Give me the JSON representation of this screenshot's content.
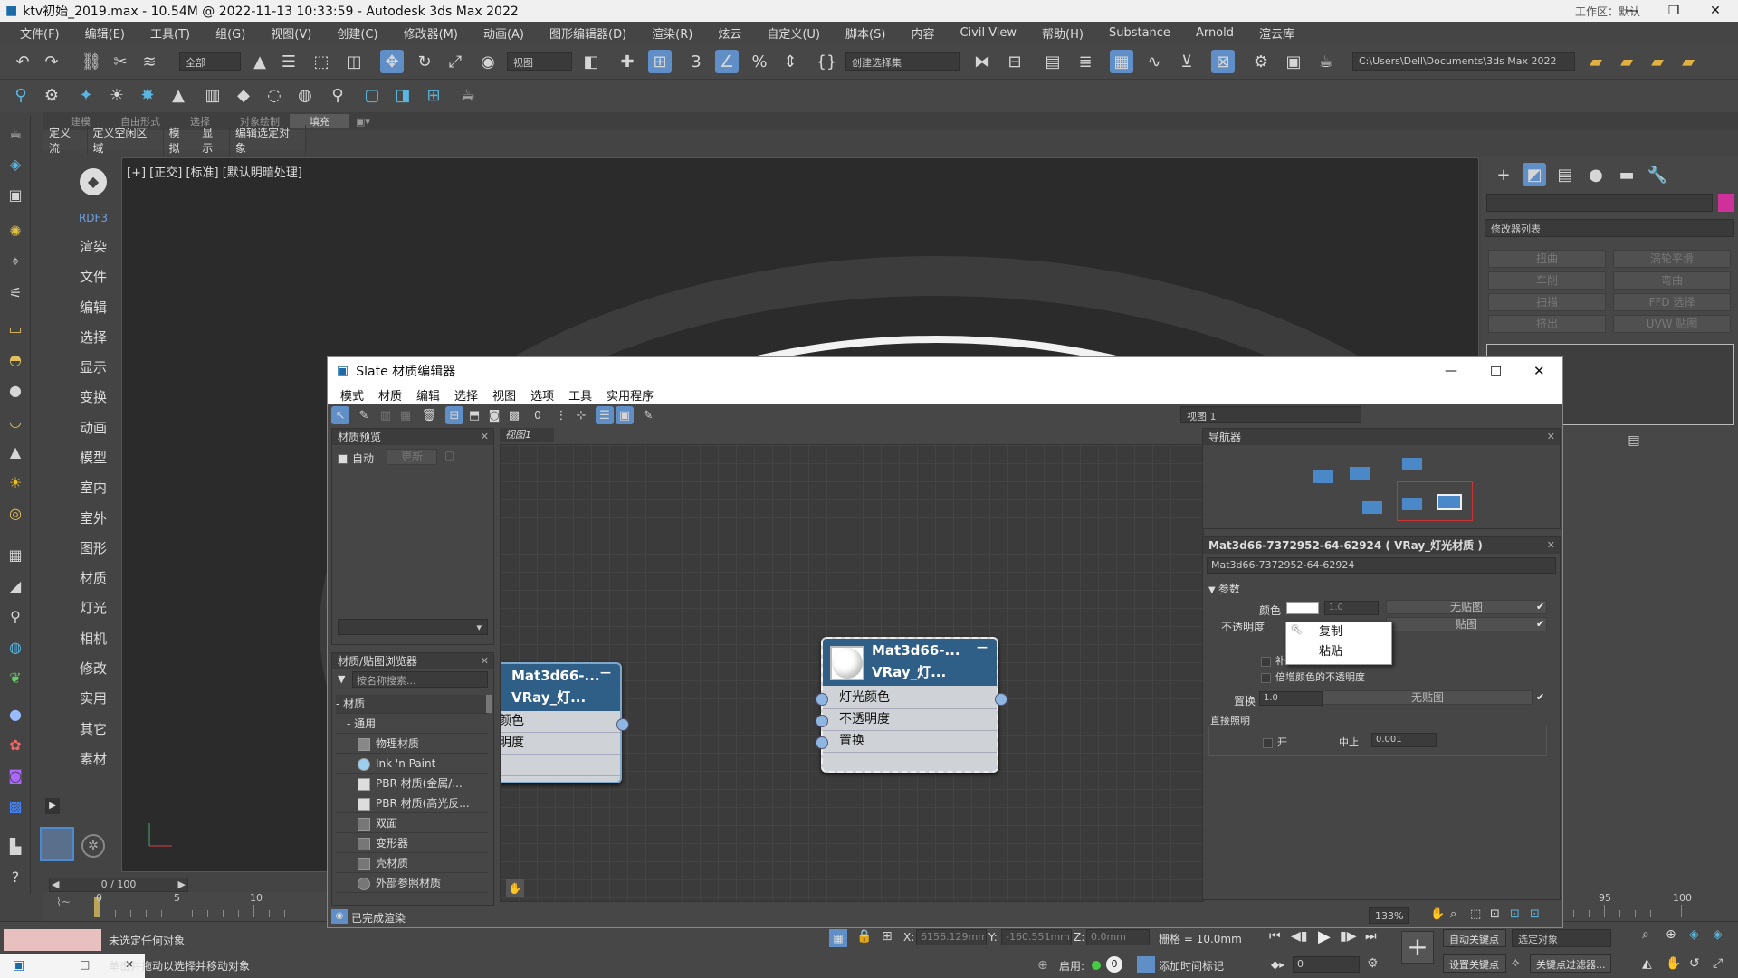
{
  "window": {
    "title": "ktv初始_2019.max - 10.54M @ 2022-11-13 10:33:59 - Autodesk 3ds Max 2022",
    "workspace_label": "工作区：默认"
  },
  "menubar": [
    "文件(F)",
    "编辑(E)",
    "工具(T)",
    "组(G)",
    "视图(V)",
    "创建(C)",
    "修改器(M)",
    "动画(A)",
    "图形编辑器(D)",
    "渲染(R)",
    "炫云",
    "自定义(U)",
    "脚本(S)",
    "内容",
    "Civil View",
    "帮助(H)",
    "Substance",
    "Arnold",
    "渲云库"
  ],
  "toolbar": {
    "filter_value": "全部",
    "view_value": "视图",
    "selection_set_placeholder": "创建选择集",
    "project_path": "C:\\Users\\Dell\\Documents\\3ds Max 2022"
  },
  "ribbon": {
    "tabs": [
      "建模",
      "自由形式",
      "选择",
      "对象绘制",
      "填充"
    ],
    "active_tab": "填充",
    "sub_tabs": [
      "定义流",
      "定义空闲区域",
      "模拟",
      "显示",
      "编辑选定对象"
    ]
  },
  "command_panel": {
    "items": [
      "RDF3",
      "渲染",
      "文件",
      "编辑",
      "选择",
      "显示",
      "变换",
      "动画",
      "模型",
      "室内",
      "室外",
      "图形",
      "材质",
      "灯光",
      "相机",
      "修改",
      "实用",
      "其它",
      "素材"
    ]
  },
  "viewport": {
    "label": "[+] [正交] [标准] [默认明暗处理]"
  },
  "modify_panel": {
    "modifier_list": "修改器列表",
    "buttons": [
      "扭曲",
      "涡轮平滑",
      "车削",
      "弯曲",
      "扫描",
      "FFD 选择",
      "挤出",
      "UVW 贴图"
    ]
  },
  "slate": {
    "title": "Slate 材质编辑器",
    "menu": [
      "模式",
      "材质",
      "编辑",
      "选择",
      "视图",
      "选项",
      "工具",
      "实用程序"
    ],
    "view_dropdown": "视图 1",
    "preview_panel": {
      "title": "材质预览",
      "auto_label": "自动",
      "update_label": "更新"
    },
    "browser": {
      "title": "材质/贴图浏览器",
      "search_placeholder": "按名称搜索...",
      "category": "- 材质",
      "subcategory": "- 通用",
      "items": [
        "物理材质",
        "Ink 'n Paint",
        "PBR 材质(金属/...",
        "PBR 材质(高光反...",
        "双面",
        "变形器",
        "壳材质",
        "外部参照材质"
      ]
    },
    "view_tab": "视图1",
    "nodes": [
      {
        "title1": "Mat3d66-...",
        "title2": "VRay_灯...",
        "slots": [
          "灯光颜色",
          "不透明度",
          "置换"
        ]
      },
      {
        "title1": "Mat3d66-...",
        "title2": "VRay_灯...",
        "slots": [
          "颜色",
          "明度",
          ""
        ]
      }
    ],
    "navigator_title": "导航器",
    "param_editor": {
      "title": "Mat3d66-7372952-64-62924 ( VRay_灯光材质 )",
      "name_field": "Mat3d66-7372952-64-62924",
      "section_params": "参数",
      "color_label": "颜色",
      "color_value": "1.0",
      "no_map": "无贴图",
      "opacity_label": "不透明度",
      "opacity_map": "贴图",
      "check1": "补偿摄影机曝光",
      "check2": "倍增颜色的不透明度",
      "displace_label": "置换",
      "displace_value": "1.0",
      "direct_section": "直接照明",
      "direct_on": "开",
      "cutoff_label": "中止",
      "cutoff_value": "0.001"
    },
    "context_menu": [
      "复制",
      "粘贴"
    ],
    "status": "已完成渲染",
    "zoom": "133%"
  },
  "timeline": {
    "frame_display": "0 / 100",
    "ticks": [
      "0",
      "5",
      "10",
      "95",
      "100"
    ]
  },
  "statusbar": {
    "msg1": "未选定任何对象",
    "msg2": "单击并拖动以选择并移动对象",
    "x_label": "X:",
    "x_value": "6156.129mm",
    "y_label": "Y:",
    "y_value": "-160.551mm",
    "z_label": "Z:",
    "z_value": "0.0mm",
    "grid": "栅格 = 10.0mm",
    "enable_label": "启用:",
    "add_time_tag": "添加时间标记",
    "auto_key": "自动关键点",
    "set_key": "设置关键点",
    "selected_object": "选定对象",
    "key_filter": "关键点过滤器...",
    "frame_field": "0"
  }
}
